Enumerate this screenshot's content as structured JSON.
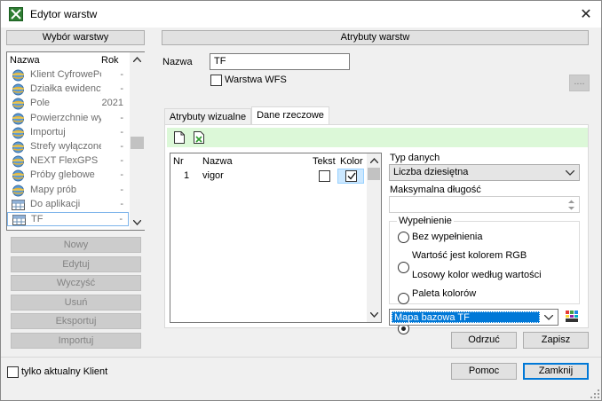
{
  "window": {
    "title": "Edytor warstw"
  },
  "left": {
    "header": "Wybór warstwy",
    "col_name": "Nazwa",
    "col_year": "Rok",
    "layers": [
      {
        "name": "Klient CyfrowePola",
        "year": "-",
        "icon": "globe-icon"
      },
      {
        "name": "Działka ewidencyjna",
        "year": "-",
        "icon": "globe-icon"
      },
      {
        "name": "Pole",
        "year": "2021",
        "icon": "globe-icon"
      },
      {
        "name": "Powierzchnie wyłączone",
        "year": "-",
        "icon": "globe-icon"
      },
      {
        "name": "Importuj",
        "year": "-",
        "icon": "globe-icon"
      },
      {
        "name": "Strefy wyłączone",
        "year": "-",
        "icon": "globe-icon"
      },
      {
        "name": "NEXT FlexGPS",
        "year": "-",
        "icon": "globe-icon"
      },
      {
        "name": "Próby glebowe",
        "year": "-",
        "icon": "globe-icon"
      },
      {
        "name": "Mapy prób",
        "year": "-",
        "icon": "globe-icon"
      },
      {
        "name": "Do aplikacji",
        "year": "-",
        "icon": "grid-icon"
      },
      {
        "name": "TF",
        "year": "-",
        "icon": "grid-icon"
      }
    ],
    "buttons": [
      "Nowy",
      "Edytuj",
      "Wyczyść",
      "Usuń",
      "Eksportuj",
      "Importuj"
    ],
    "only_client_label": "tylko aktualny Klient"
  },
  "right": {
    "header": "Atrybuty warstw",
    "name_label": "Nazwa",
    "name_value": "TF",
    "wfs_label": "Warstwa WFS",
    "more_label": "....",
    "tabs": [
      "Atrybuty wizualne",
      "Dane rzeczowe"
    ],
    "table": {
      "col_nr": "Nr",
      "col_name": "Nazwa",
      "col_text": "Tekst",
      "col_color": "Kolor",
      "rows": [
        {
          "nr": "1",
          "name": "vigor"
        }
      ]
    },
    "data_type_label": "Typ danych",
    "data_type_value": "Liczba dziesiętna",
    "max_len_label": "Maksymalna długość",
    "fill_label": "Wypełnienie",
    "fill_options": [
      "Bez wypełnienia",
      "Wartość jest kolorem RGB",
      "Losowy kolor według wartości",
      "Paleta kolorów"
    ],
    "palette_value": "Mapa bazowa TF",
    "discard_label": "Odrzuć",
    "save_label": "Zapisz"
  },
  "footer": {
    "help_label": "Pomoc",
    "close_label": "Zamknij"
  },
  "colors": {
    "accent": "#0078d7",
    "green_bar": "#dcf8d8",
    "selection": "#cce8ff"
  }
}
